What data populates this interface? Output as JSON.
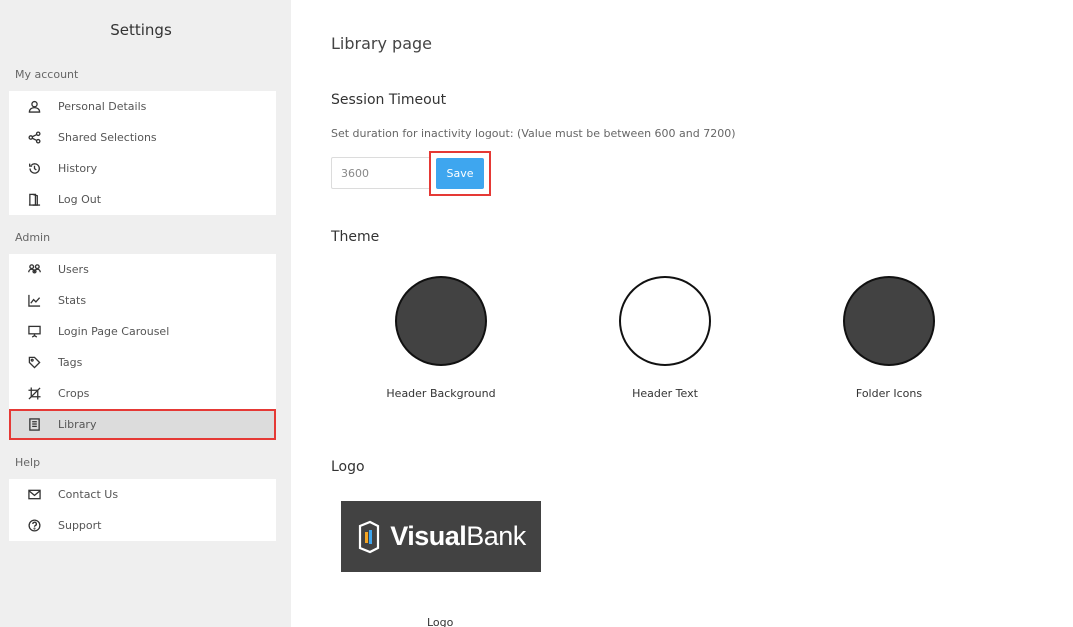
{
  "sidebar": {
    "title": "Settings",
    "groups": [
      {
        "label": "My account",
        "items": [
          {
            "label": "Personal Details",
            "icon": "user-icon"
          },
          {
            "label": "Shared Selections",
            "icon": "share-icon"
          },
          {
            "label": "History",
            "icon": "history-icon"
          },
          {
            "label": "Log Out",
            "icon": "logout-icon"
          }
        ]
      },
      {
        "label": "Admin",
        "items": [
          {
            "label": "Users",
            "icon": "users-icon"
          },
          {
            "label": "Stats",
            "icon": "chart-icon"
          },
          {
            "label": "Login Page Carousel",
            "icon": "presentation-icon"
          },
          {
            "label": "Tags",
            "icon": "tag-icon"
          },
          {
            "label": "Crops",
            "icon": "crop-icon"
          },
          {
            "label": "Library",
            "icon": "book-icon",
            "active": true
          }
        ]
      },
      {
        "label": "Help",
        "items": [
          {
            "label": "Contact Us",
            "icon": "mail-icon"
          },
          {
            "label": "Support",
            "icon": "help-circle-icon"
          }
        ]
      }
    ]
  },
  "main": {
    "title": "Library page",
    "session": {
      "heading": "Session Timeout",
      "description": "Set duration for inactivity logout: (Value must be between 600 and 7200)",
      "value": "3600",
      "save_label": "Save"
    },
    "theme": {
      "heading": "Theme",
      "swatches": [
        {
          "label": "Header Background",
          "color": "#424242"
        },
        {
          "label": "Header Text",
          "color": "#ffffff"
        },
        {
          "label": "Folder Icons",
          "color": "#424242"
        }
      ]
    },
    "logo": {
      "heading": "Logo",
      "brand_bold": "Visual",
      "brand_light": "Bank",
      "caption": "Logo"
    }
  },
  "colors": {
    "accent": "#3ea6ef",
    "highlight": "#e53935",
    "sidebar_bg": "#efefef"
  }
}
